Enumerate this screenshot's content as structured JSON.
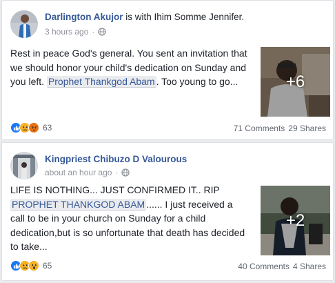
{
  "posts": [
    {
      "author": "Darlington Akujor",
      "with_text": "is with",
      "tagged": "Ihim Somme Jennifer",
      "tagged_suffix": ".",
      "time": "3 hours ago",
      "time_separator": "·",
      "audience_icon": "globe-icon",
      "text_before": "Rest in peace God's general. You sent an invitation that we should honor your child's dedication on Sunday and you left.",
      "mention": "Prophet Thankgod Abam",
      "text_after": ". Too young to go...",
      "photo_more": "+6",
      "reaction_icons": [
        "like-icon",
        "sad-icon",
        "angry-icon"
      ],
      "reaction_count": "63",
      "comments": "71 Comments",
      "shares": "29 Shares"
    },
    {
      "author": "Kingpriest Chibuzo D Valourous",
      "time": "about an hour ago",
      "time_separator": "·",
      "audience_icon": "globe-icon",
      "text_before": "LIFE IS NOTHING... JUST CONFIRMED IT.. RIP",
      "mention": "PROPHET THANKGOD ABAM",
      "text_after": "...... I just received a call to be in your church on Sunday for a child dedication,but is so unfortunate that death has decided to take...",
      "photo_more": "+2",
      "reaction_icons": [
        "like-icon",
        "sad-icon",
        "wow-icon"
      ],
      "reaction_count": "65",
      "comments": "40 Comments",
      "shares": "4 Shares"
    }
  ],
  "colors": {
    "link": "#365899",
    "like": "#1877f2",
    "sad": "#f7b125",
    "angry": "#e9710f",
    "meta": "#90949c"
  }
}
